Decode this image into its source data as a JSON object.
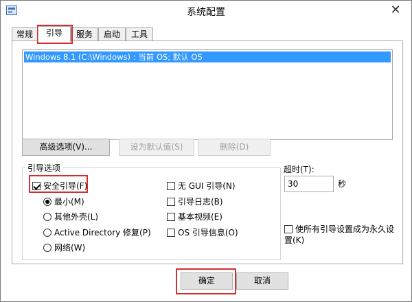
{
  "window": {
    "title": "系统配置",
    "close_glyph": "✕"
  },
  "tabs": [
    {
      "label": "常规"
    },
    {
      "label": "引导"
    },
    {
      "label": "服务"
    },
    {
      "label": "启动"
    },
    {
      "label": "工具"
    }
  ],
  "active_tab": "引导",
  "boot_entries": [
    {
      "label": "Windows 8.1 (C:\\Windows) : 当前 OS; 默认 OS",
      "selected": true
    }
  ],
  "buttons": {
    "advanced": "高级选项(V)...",
    "set_default": "设为默认值(S)",
    "delete": "删除(D)",
    "ok": "确定",
    "cancel": "取消"
  },
  "boot_options": {
    "group_label": "引导选项",
    "safe_boot": {
      "label": "安全引导(F)",
      "checked": true
    },
    "radios": [
      {
        "label": "最小(M)",
        "checked": true
      },
      {
        "label": "其他外壳(L)",
        "checked": false
      },
      {
        "label": "Active Directory 修复(P)",
        "checked": false
      },
      {
        "label": "网络(W)",
        "checked": false
      }
    ],
    "right_checks": [
      {
        "label": "无 GUI 引导(N)",
        "checked": false
      },
      {
        "label": "引导日志(B)",
        "checked": false
      },
      {
        "label": "基本视频(E)",
        "checked": false
      },
      {
        "label": "OS 引导信息(O)",
        "checked": false
      }
    ]
  },
  "timeout": {
    "label": "超时(T):",
    "value": "30",
    "unit": "秒"
  },
  "permanent": {
    "label": "使所有引导设置成为永久设置(K)",
    "checked": false
  },
  "colors": {
    "selection": "#3399ff",
    "highlight_box": "#d32f2f",
    "window_bg": "#ffffff"
  }
}
